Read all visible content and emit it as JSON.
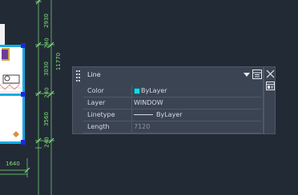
{
  "drawing": {
    "dimensions_vertical": [
      "2930",
      "3030",
      "11770",
      "3560",
      "240",
      "240",
      "240"
    ],
    "dimensions_horizontal": [
      "1640"
    ]
  },
  "palette": {
    "object_type": "Line",
    "properties": [
      {
        "label": "Color",
        "value": "ByLayer"
      },
      {
        "label": "Layer",
        "value": "WINDOW"
      },
      {
        "label": "Linetype",
        "value": "ByLayer"
      },
      {
        "label": "Length",
        "value": "7120"
      }
    ],
    "colors": {
      "background": "#222a35",
      "panel": "#3b4453",
      "wall": "#19a9e6",
      "dimension": "#7fe07a",
      "swatch": "#17d9e8"
    }
  }
}
